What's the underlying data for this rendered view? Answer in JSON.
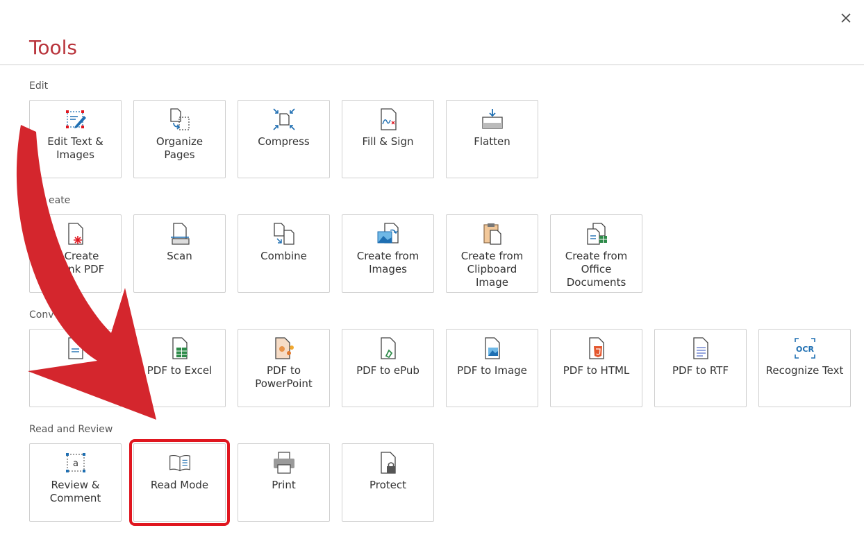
{
  "dialog": {
    "title": "Tools",
    "close_label": "×"
  },
  "sections": [
    {
      "label": "Edit",
      "tools": [
        {
          "label": "Edit Text &\nImages",
          "icon": "edit-text-icon"
        },
        {
          "label": "Organize\nPages",
          "icon": "organize-pages-icon"
        },
        {
          "label": "Compress",
          "icon": "compress-icon"
        },
        {
          "label": "Fill & Sign",
          "icon": "fill-sign-icon"
        },
        {
          "label": "Flatten",
          "icon": "flatten-icon"
        }
      ]
    },
    {
      "label": "eate",
      "tools": [
        {
          "label": "Create\nlank PDF",
          "icon": "create-blank-pdf-icon"
        },
        {
          "label": "Scan",
          "icon": "scan-icon"
        },
        {
          "label": "Combine",
          "icon": "combine-icon"
        },
        {
          "label": "Create from\nImages",
          "icon": "create-from-images-icon"
        },
        {
          "label": "Create from\nClipboard Image",
          "icon": "clipboard-icon"
        },
        {
          "label": "Create from\nOffice\nDocuments",
          "icon": "office-documents-icon"
        }
      ]
    },
    {
      "label": "Conv",
      "tools": [
        {
          "label": "",
          "icon": "pdf-to-word-icon"
        },
        {
          "label": "PDF to Excel",
          "icon": "pdf-to-excel-icon"
        },
        {
          "label": "PDF to\nPowerPoint",
          "icon": "pdf-to-powerpoint-icon"
        },
        {
          "label": "PDF to ePub",
          "icon": "pdf-to-epub-icon"
        },
        {
          "label": "PDF to Image",
          "icon": "pdf-to-image-icon"
        },
        {
          "label": "PDF to HTML",
          "icon": "pdf-to-html-icon"
        },
        {
          "label": "PDF to RTF",
          "icon": "pdf-to-rtf-icon"
        },
        {
          "label": "Recognize Text",
          "icon": "ocr-icon"
        }
      ]
    },
    {
      "label": "Read and Review",
      "tools": [
        {
          "label": "Review &\nComment",
          "icon": "review-comment-icon"
        },
        {
          "label": "Read Mode",
          "icon": "read-mode-icon"
        },
        {
          "label": "Print",
          "icon": "printer-icon"
        },
        {
          "label": "Protect",
          "icon": "lock-icon"
        }
      ]
    }
  ],
  "icon_texts": {
    "ocr": "OCR",
    "review": "a"
  },
  "colors": {
    "title": "#b8323a",
    "highlight": "#e0161f",
    "arrow": "#d4262d",
    "accent_blue": "#1f6fb2"
  }
}
